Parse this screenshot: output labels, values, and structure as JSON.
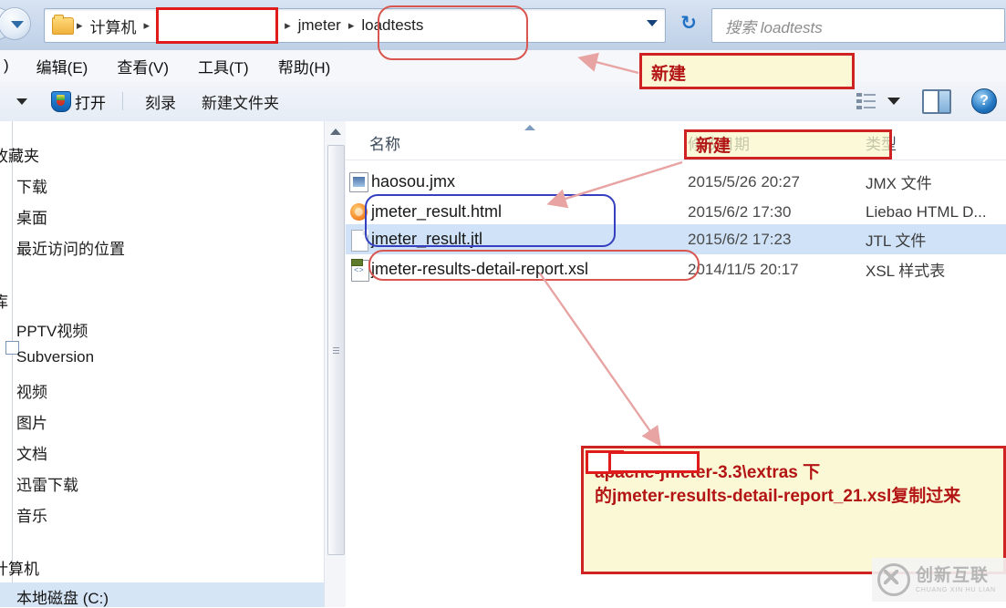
{
  "window": {
    "title": "loadtests"
  },
  "address_bar": {
    "folder_icon": "folder-icon",
    "crumbs": [
      {
        "label": "计算机",
        "redacted": false
      },
      {
        "label": "",
        "redacted": true
      },
      {
        "label": "jmeter",
        "redacted": false
      },
      {
        "label": "loadtests",
        "redacted": false
      }
    ],
    "separator": "▸",
    "dropdown_icon": "chevron-down-icon",
    "refresh_icon": "refresh-icon",
    "back_icon": "back-arrow-icon",
    "forward_icon": "forward-arrow-icon"
  },
  "search": {
    "placeholder": "搜索 loadtests",
    "icon": "search-icon"
  },
  "menu": {
    "cut_off_left": ")",
    "items": [
      "编辑(E)",
      "查看(V)",
      "工具(T)",
      "帮助(H)"
    ]
  },
  "toolbar": {
    "organize_caret": "chevron-down-icon",
    "open_label": "打开",
    "open_icon": "shield-icon",
    "burn_label": "刻录",
    "new_folder_label": "新建文件夹",
    "view_icon": "view-list-icon",
    "view_caret": "chevron-down-icon",
    "preview_pane_icon": "preview-pane-icon",
    "help_icon": "help-icon",
    "help_glyph": "?"
  },
  "nav_pane": {
    "items": [
      {
        "label": "收藏夹",
        "type": "group",
        "clipped": true
      },
      {
        "label": "下载",
        "type": "child"
      },
      {
        "label": "桌面",
        "type": "child"
      },
      {
        "label": "最近访问的位置",
        "type": "child"
      },
      {
        "label": "库",
        "type": "group",
        "clipped": true
      },
      {
        "label": "PPTV视频",
        "type": "child"
      },
      {
        "label": "Subversion",
        "type": "child",
        "expander": true
      },
      {
        "label": "视频",
        "type": "child"
      },
      {
        "label": "图片",
        "type": "child"
      },
      {
        "label": "文档",
        "type": "child"
      },
      {
        "label": "迅雷下载",
        "type": "child"
      },
      {
        "label": "音乐",
        "type": "child"
      },
      {
        "label": "计算机",
        "type": "group",
        "clipped": true
      },
      {
        "label": "本地磁盘 (C:)",
        "type": "child",
        "selected": true
      }
    ],
    "scrollbar": {
      "up_arrow_icon": "scroll-up-arrow-icon",
      "grip_icon": "splitter-grip-icon"
    }
  },
  "file_list": {
    "columns": [
      "名称",
      "修改日期",
      "类型"
    ],
    "sort_indicator": "sort-ascending-icon",
    "rows": [
      {
        "name": "haosou.jmx",
        "date": "2015/5/26 20:27",
        "type": "JMX 文件",
        "icon": "jmx-file-icon",
        "selected": false
      },
      {
        "name": "jmeter_result.html",
        "date": "2015/6/2 17:30",
        "type": "Liebao HTML D...",
        "icon": "html-file-icon",
        "selected": false
      },
      {
        "name": "jmeter_result.jtl",
        "date": "2015/6/2 17:23",
        "type": "JTL 文件",
        "icon": "blank-file-icon",
        "selected": true
      },
      {
        "name": "jmeter-results-detail-report.xsl",
        "date": "2014/11/5 20:17",
        "type": "XSL 样式表",
        "icon": "xsl-file-icon",
        "selected": false
      }
    ]
  },
  "annotations": {
    "new_top": "新建",
    "new_header": "新建",
    "copy_note_line1": "apache-jmeter-3.3\\extras 下",
    "copy_note_line2": "的jmeter-results-detail-report_21.xsl复制过来"
  },
  "watermark": {
    "cn": "创新互联",
    "en": "CHUANG XIN HU LIAN",
    "logo": "circle-x-logo-icon"
  },
  "colors": {
    "annotation_border": "#cf2222",
    "annotation_fill": "#fbf8d6",
    "annotation_text": "#b31414",
    "selection_blue": "#cfe2f7",
    "highlight_blue": "#3440c0",
    "highlight_red": "#d9554f",
    "redact_red": "#e01b1b"
  }
}
